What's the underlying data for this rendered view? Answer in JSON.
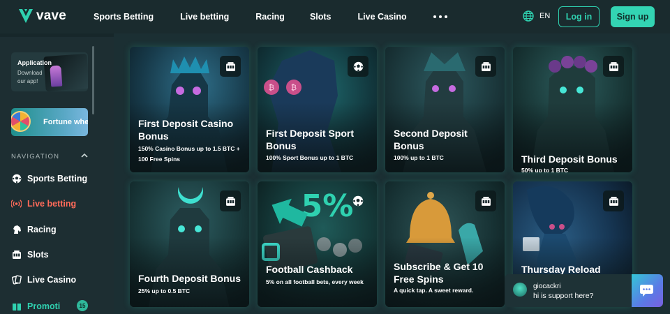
{
  "brand": {
    "name": "vave",
    "accent": "#2fd1b0",
    "live_color": "#ff6b5a"
  },
  "header": {
    "nav": [
      "Sports Betting",
      "Live betting",
      "Racing",
      "Slots",
      "Live Casino"
    ],
    "more_icon": "more-dots-icon",
    "language": "EN",
    "login_label": "Log in",
    "signup_label": "Sign up"
  },
  "sidebar": {
    "app_card": {
      "title": "Application",
      "subtitle": "Download our app!"
    },
    "fortune_label": "Fortune whe",
    "nav_heading": "NAVIGATION",
    "items": [
      {
        "label": "Sports Betting",
        "icon": "soccer-ball-icon"
      },
      {
        "label": "Live betting",
        "icon": "live-broadcast-icon"
      },
      {
        "label": "Racing",
        "icon": "horse-head-icon"
      },
      {
        "label": "Slots",
        "icon": "slot-machine-icon"
      },
      {
        "label": "Live Casino",
        "icon": "live-casino-icon"
      },
      {
        "label": "Promoti",
        "icon": "promotions-icon",
        "badge": "15"
      }
    ]
  },
  "promotions": [
    {
      "title": "First Deposit Casino Bonus",
      "description": "150% Casino Bonus up to 1.5 BTC + 100 Free Spins",
      "type_icon": "slot-machine-icon"
    },
    {
      "title": "First Deposit Sport Bonus",
      "description": "100% Sport Bonus up to 1 BTC",
      "type_icon": "soccer-ball-icon"
    },
    {
      "title": "Second Deposit Bonus",
      "description": "100% up to 1 BTC",
      "type_icon": "slot-machine-icon"
    },
    {
      "title": "Third Deposit Bonus",
      "description": "50% up to 1 BTC",
      "type_icon": "slot-machine-icon"
    },
    {
      "title": "Fourth Deposit Bonus",
      "description": "25% up to 0.5 BTC",
      "type_icon": "slot-machine-icon"
    },
    {
      "title": "Football Cashback",
      "description": "5% on all football bets, every week",
      "type_icon": "soccer-ball-icon"
    },
    {
      "title": "Subscribe & Get 10 Free Spins",
      "description": "A quick tap. A sweet reward.",
      "type_icon": "slot-machine-icon"
    },
    {
      "title": "Thursday Reload",
      "description": "",
      "type_icon": "slot-machine-icon"
    }
  ],
  "chat": {
    "agent_name": "giocackri",
    "message": "hi is support here?",
    "icon": "chat-bubbles-icon"
  }
}
